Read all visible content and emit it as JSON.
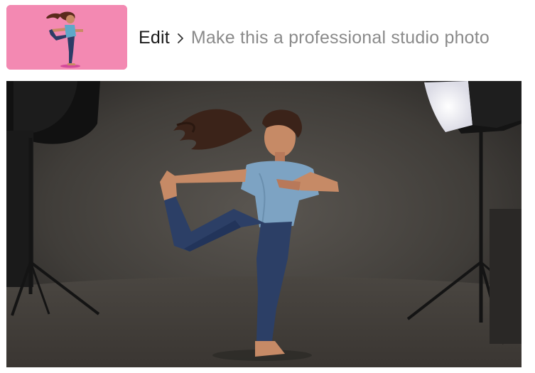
{
  "breadcrumb": {
    "root": "Edit",
    "separator_icon": "chevron-right-icon",
    "prompt": "Make this a professional studio photo"
  },
  "thumbnail": {
    "description_icon": "cartoon-dancer-thumbnail",
    "background_color": "#f389b2"
  },
  "result_image": {
    "icon": "studio-photo-dancer"
  },
  "colors": {
    "text_primary": "#1a1a1a",
    "text_muted": "#8a8a8a",
    "thumb_bg": "#f389b2"
  }
}
